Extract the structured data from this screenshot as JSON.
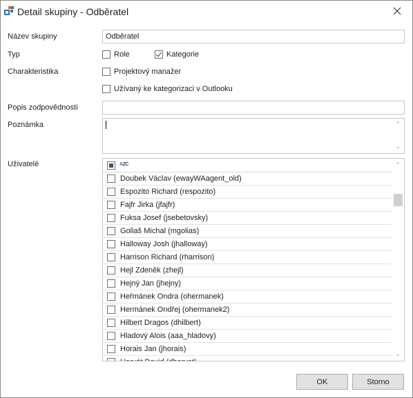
{
  "window": {
    "title": "Detail skupiny - Odběratel",
    "icon": "group-detail-icon",
    "close_icon": "close-icon"
  },
  "form": {
    "group_name_label": "Název skupiny",
    "group_name_value": "Odběratel",
    "type_label": "Typ",
    "type_role_label": "Role",
    "type_role_checked": false,
    "type_category_label": "Kategorie",
    "type_category_checked": true,
    "characteristics_label": "Charakteristika",
    "project_manager_label": "Projektový manažer",
    "project_manager_checked": false,
    "outlook_categorization_label": "Užívaný ke kategorizaci v Outlooku",
    "outlook_categorization_checked": false,
    "responsibility_label": "Popis zodpovědnosti",
    "responsibility_value": "",
    "note_label": "Poznámka",
    "note_value": "",
    "users_label": "Uživatelé"
  },
  "users": {
    "sort_icon": "sort-az-icon",
    "items": [
      {
        "name": "Doubek Václav (ewayWAagent_old)",
        "checked": false
      },
      {
        "name": "Espozito Richard (respozito)",
        "checked": false
      },
      {
        "name": "Fajfr Jirka (jfajfr)",
        "checked": false
      },
      {
        "name": "Fuksa Josef (jsebetovsky)",
        "checked": false
      },
      {
        "name": "Goliaš Michal (mgolias)",
        "checked": false
      },
      {
        "name": "Halloway Josh (jhalloway)",
        "checked": false
      },
      {
        "name": "Harrison Richard (rharrison)",
        "checked": false
      },
      {
        "name": "Hejl Zdeněk (zhejl)",
        "checked": false
      },
      {
        "name": "Hejný Jan (jhejny)",
        "checked": false
      },
      {
        "name": "Heřmánek Ondra (ohermanek)",
        "checked": false
      },
      {
        "name": "Hermánek Ondřej (ohermanek2)",
        "checked": false
      },
      {
        "name": "Hilbert Dragos (dhilbert)",
        "checked": false
      },
      {
        "name": "Hladový Alois (aaa_hladovy)",
        "checked": false
      },
      {
        "name": "Horais Jan (jhorais)",
        "checked": false
      },
      {
        "name": "Horvát David (dhorvat)",
        "checked": false
      }
    ]
  },
  "buttons": {
    "ok_label": "OK",
    "cancel_label": "Storno"
  }
}
